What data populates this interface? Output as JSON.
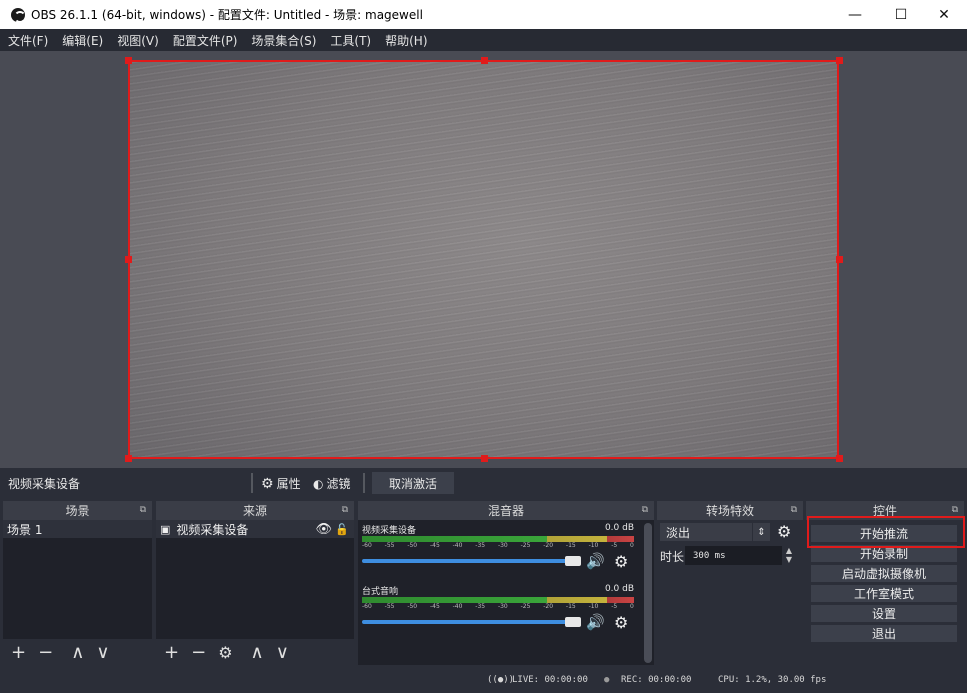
{
  "window": {
    "title": "OBS 26.1.1 (64-bit, windows) - 配置文件: Untitled - 场景: magewell",
    "minimize": "—",
    "maximize": "☐",
    "close": "✕"
  },
  "menubar": {
    "items": [
      "文件(F)",
      "编辑(E)",
      "视图(V)",
      "配置文件(P)",
      "场景集合(S)",
      "工具(T)",
      "帮助(H)"
    ]
  },
  "source_toolbar": {
    "current_source": "视频采集设备",
    "properties_label": "属性",
    "filters_label": "滤镜",
    "deactivate_label": "取消激活"
  },
  "scenes": {
    "header": "场景",
    "items": [
      "场景 1"
    ],
    "footer_icons": [
      "+",
      "−",
      "∧",
      "∨"
    ]
  },
  "sources": {
    "header": "来源",
    "items": [
      "视频采集设备"
    ],
    "footer_icons": [
      "+",
      "−",
      "⚙",
      "∧",
      "∨"
    ]
  },
  "mixer": {
    "header": "混音器",
    "channels": [
      {
        "name": "视频采集设备",
        "db": "0.0 dB",
        "volume": 1.0
      },
      {
        "name": "台式音响",
        "db": "0.0 dB",
        "volume": 1.0
      }
    ],
    "ticks": [
      "-60",
      "-55",
      "-50",
      "-45",
      "-40",
      "-35",
      "-30",
      "-25",
      "-20",
      "-15",
      "-10",
      "-5",
      "0"
    ]
  },
  "transitions": {
    "header": "转场特效",
    "selected": "淡出",
    "duration_label": "时长",
    "duration_value": "300 ms"
  },
  "controls": {
    "header": "控件",
    "buttons": [
      "开始推流",
      "开始录制",
      "启动虚拟摄像机",
      "工作室模式",
      "设置",
      "退出"
    ],
    "highlighted_button": "开始推流",
    "highlight_color": "#e01b1b"
  },
  "status": {
    "live": "LIVE: 00:00:00",
    "rec": "REC: 00:00:00",
    "cpu": "CPU: 1.2%, 30.00 fps"
  },
  "colors": {
    "selection_border": "#e01b1b",
    "volume_bar": "#3e8ee0"
  }
}
